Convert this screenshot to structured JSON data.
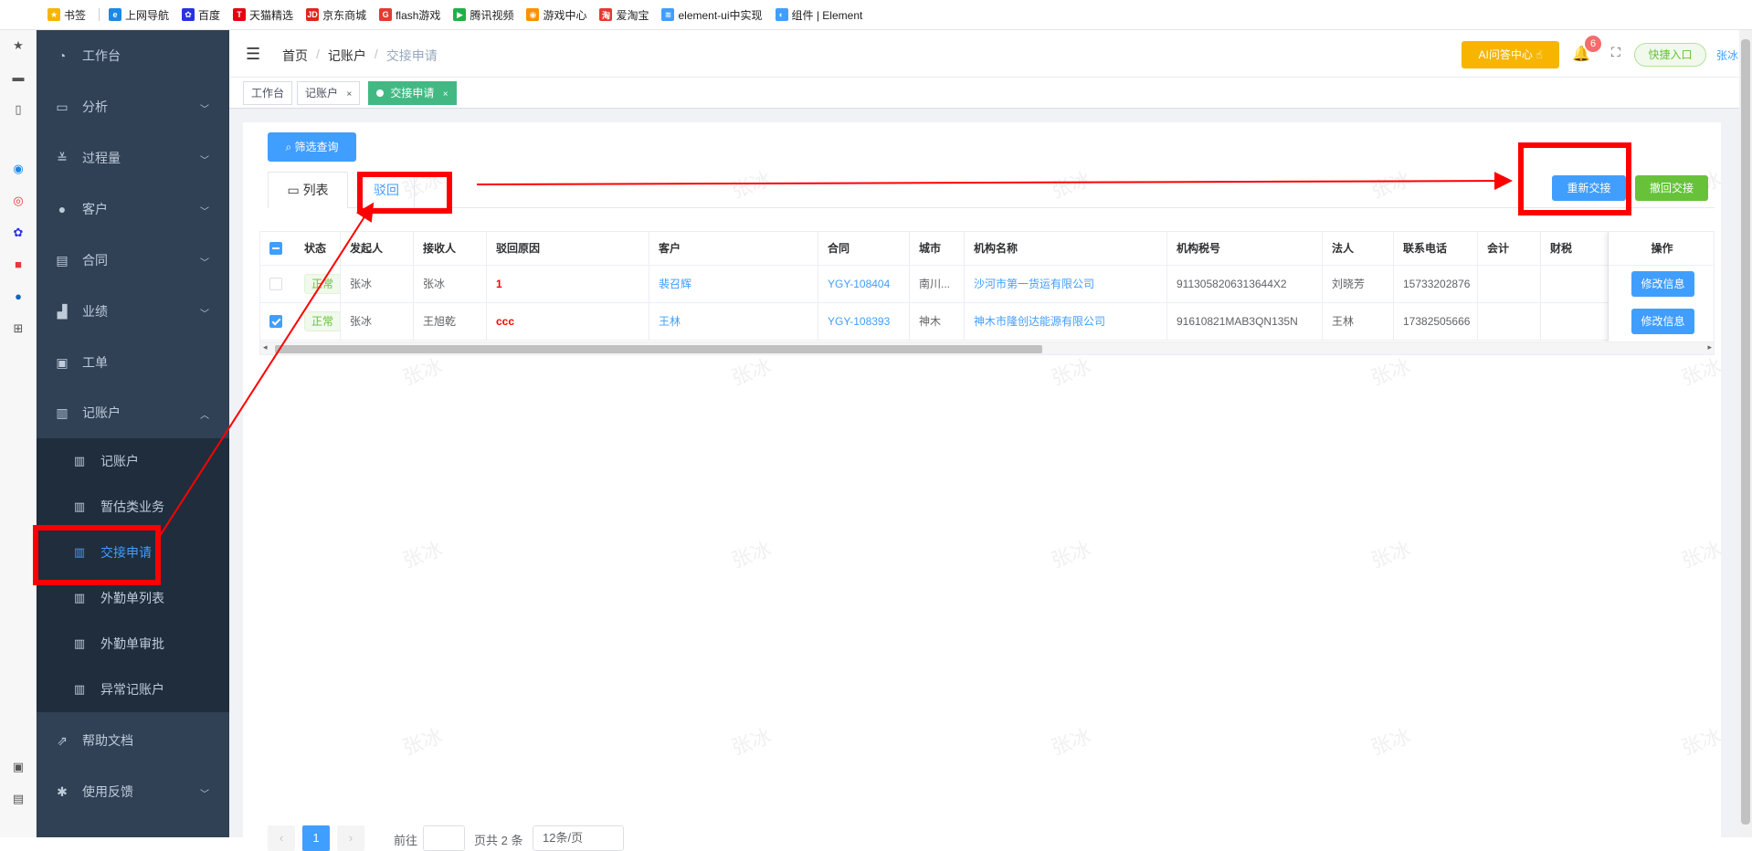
{
  "bookmarks": [
    {
      "label": "书签",
      "color": "#f7b500",
      "glyph": "★"
    },
    {
      "label": "上网导航",
      "color": "#1e88e5",
      "glyph": "e"
    },
    {
      "label": "百度",
      "color": "#2932e1",
      "glyph": "✿"
    },
    {
      "label": "天猫精选",
      "color": "#e60012",
      "glyph": "T"
    },
    {
      "label": "京东商城",
      "color": "#e1251b",
      "glyph": "JD"
    },
    {
      "label": "flash游戏",
      "color": "#e53935",
      "glyph": "G"
    },
    {
      "label": "腾讯视频",
      "color": "#20b04a",
      "glyph": "▶"
    },
    {
      "label": "游戏中心",
      "color": "#ff8f00",
      "glyph": "◉"
    },
    {
      "label": "爱淘宝",
      "color": "#e53935",
      "glyph": "淘"
    },
    {
      "label": "element-ui中实现",
      "color": "#409eff",
      "glyph": "≋"
    },
    {
      "label": "组件 | Element",
      "color": "#409eff",
      "glyph": "◐"
    }
  ],
  "sidebar": {
    "items": [
      {
        "label": "工作台",
        "icon": "dashboard-icon"
      },
      {
        "label": "分析",
        "icon": "chart-icon"
      },
      {
        "label": "过程量",
        "icon": "process-icon"
      },
      {
        "label": "客户",
        "icon": "user-icon"
      },
      {
        "label": "合同",
        "icon": "document-icon"
      },
      {
        "label": "业绩",
        "icon": "performance-icon"
      },
      {
        "label": "工单",
        "icon": "clipboard-icon"
      },
      {
        "label": "记账户",
        "icon": "book-icon"
      }
    ],
    "submenu": [
      {
        "label": "记账户"
      },
      {
        "label": "暂估类业务"
      },
      {
        "label": "交接申请"
      },
      {
        "label": "外勤单列表"
      },
      {
        "label": "外勤单审批"
      },
      {
        "label": "异常记账户"
      }
    ],
    "bottom_items": [
      {
        "label": "帮助文档",
        "icon": "external-link-icon"
      },
      {
        "label": "使用反馈",
        "icon": "bug-icon"
      }
    ]
  },
  "navbar": {
    "breadcrumb": [
      "首页",
      "记账户",
      "交接申请"
    ],
    "ai_button": "AI问答中心 ☝",
    "notification_count": "6",
    "quick_entry": "快捷入口",
    "username": "张冰"
  },
  "tags": [
    {
      "label": "工作台"
    },
    {
      "label": "记账户",
      "close": "×"
    },
    {
      "label": "交接申请",
      "close": "×"
    }
  ],
  "toolbar": {
    "filter_button": "筛选查询",
    "tab_list": "列表",
    "tab_reject": "驳回",
    "reconnect_button": "重新交接",
    "withdraw_button": "撤回交接"
  },
  "table": {
    "headers": [
      "状态",
      "发起人",
      "接收人",
      "驳回原因",
      "客户",
      "合同",
      "城市",
      "机构名称",
      "机构税号",
      "法人",
      "联系电话",
      "会计",
      "财税",
      "操作"
    ],
    "rows": [
      {
        "checked": false,
        "status": "正常",
        "initiator": "张冰",
        "receiver": "张冰",
        "reason": "1",
        "customer": "裴召辉",
        "contract": "YGY-108404",
        "city": "南川...",
        "org": "沙河市第一货运有限公司",
        "tax": "9113058206313644X2",
        "legal": "刘晓芳",
        "phone": "15733202876",
        "accountant": "",
        "finance": "",
        "op": "修改信息"
      },
      {
        "checked": true,
        "status": "正常",
        "initiator": "张冰",
        "receiver": "王旭乾",
        "reason": "ccc",
        "customer": "王林",
        "contract": "YGY-108393",
        "city": "神木",
        "org": "神木市隆创达能源有限公司",
        "tax": "91610821MAB3QN135N",
        "legal": "王林",
        "phone": "17382505666",
        "accountant": "",
        "finance": "",
        "op": "修改信息"
      }
    ]
  },
  "pagination": {
    "current": "1",
    "goto": "前往",
    "total_text": "页共 2 条",
    "page_size": "12条/页"
  },
  "watermark": "张冰",
  "colors": {
    "sidebar": "#304156",
    "primary": "#409eff",
    "success": "#67c23a",
    "annotation": "#ff0000"
  }
}
